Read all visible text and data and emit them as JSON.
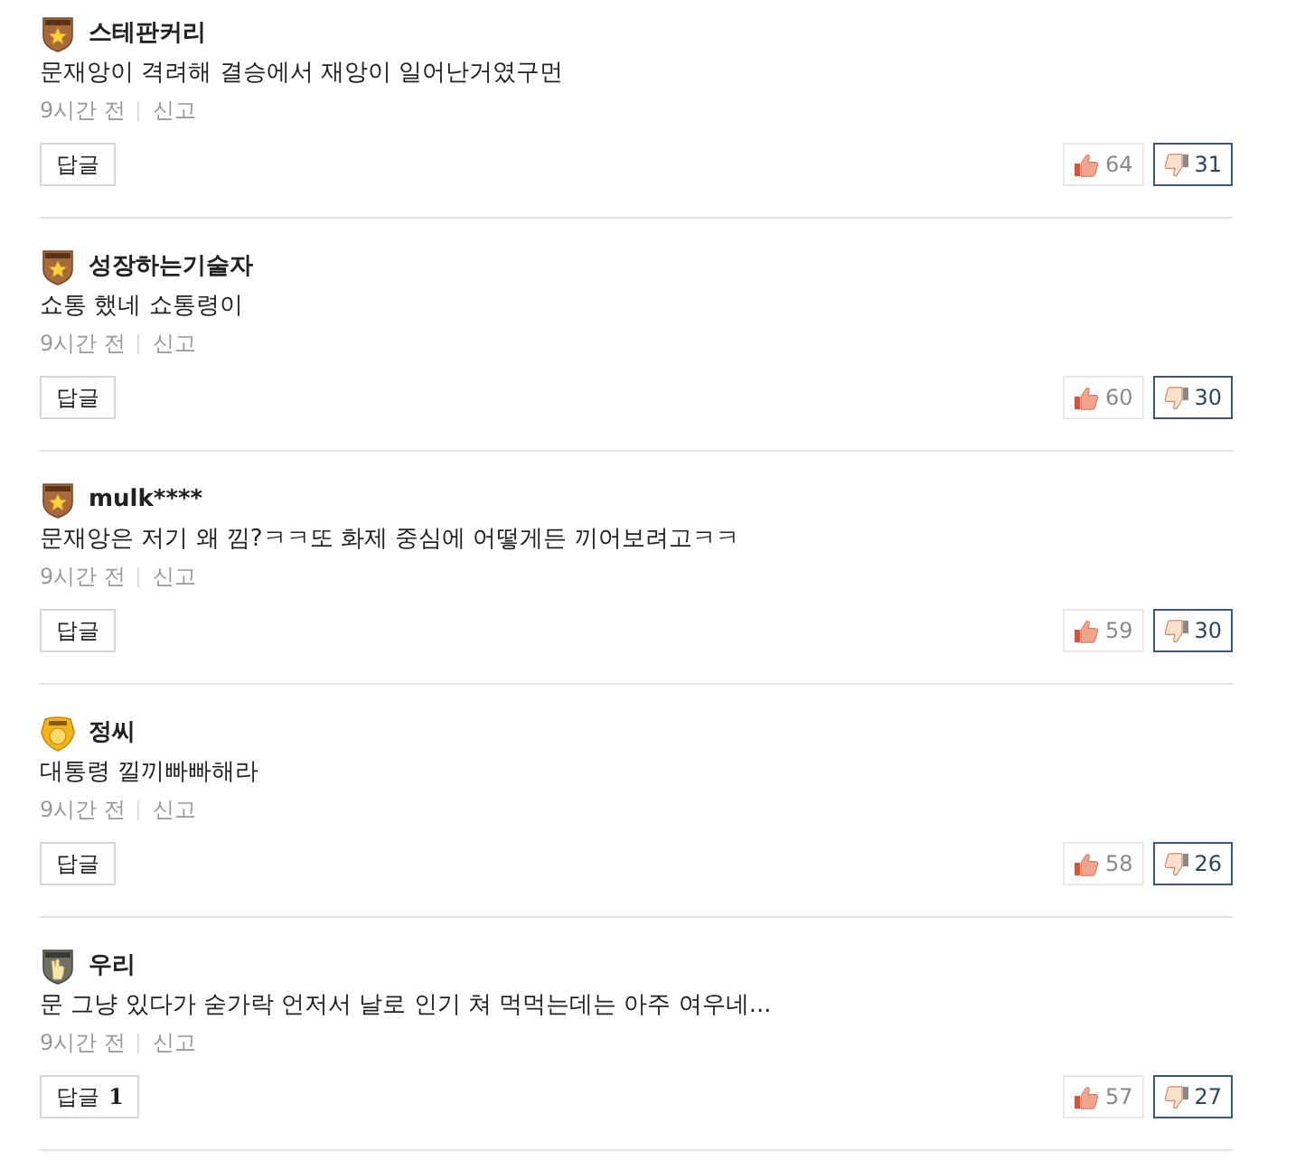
{
  "comments": [
    {
      "author": "스테판커리",
      "badge": {
        "kind": "star-shield"
      },
      "text": "문재앙이 격려해 결승에서 재앙이 일어난거였구먼",
      "time": "9시간 전",
      "report": "신고",
      "reply": {
        "label": "답글"
      },
      "like": {
        "count": "64",
        "selected": false
      },
      "dislike": {
        "count": "31",
        "selected": true
      }
    },
    {
      "author": "성장하는기술자",
      "badge": {
        "kind": "star-shield"
      },
      "text": "쇼통 했네 쇼통령이",
      "time": "9시간 전",
      "report": "신고",
      "reply": {
        "label": "답글"
      },
      "like": {
        "count": "60",
        "selected": false
      },
      "dislike": {
        "count": "30",
        "selected": true
      }
    },
    {
      "author": "mulk****",
      "badge": {
        "kind": "star-shield"
      },
      "text": "문재앙은 저기 왜 낌?ㅋㅋ또 화제 중심에 어떻게든 끼어보려고ㅋㅋ",
      "time": "9시간 전",
      "report": "신고",
      "reply": {
        "label": "답글"
      },
      "like": {
        "count": "59",
        "selected": false
      },
      "dislike": {
        "count": "30",
        "selected": true
      }
    },
    {
      "author": "정씨",
      "badge": {
        "kind": "gold-crest"
      },
      "text": "대통령 낄끼빠빠해라",
      "time": "9시간 전",
      "report": "신고",
      "reply": {
        "label": "답글"
      },
      "like": {
        "count": "58",
        "selected": false
      },
      "dislike": {
        "count": "26",
        "selected": true
      }
    },
    {
      "author": "우리",
      "badge": {
        "kind": "hand-shield"
      },
      "text": "문 그냥 있다가 숟가락 언저서 날로 인기 쳐 먹먹는데는 아주 여우네...",
      "time": "9시간 전",
      "report": "신고",
      "reply": {
        "label": "답글",
        "count": "1"
      },
      "like": {
        "count": "57",
        "selected": false
      },
      "dislike": {
        "count": "27",
        "selected": true
      }
    }
  ]
}
